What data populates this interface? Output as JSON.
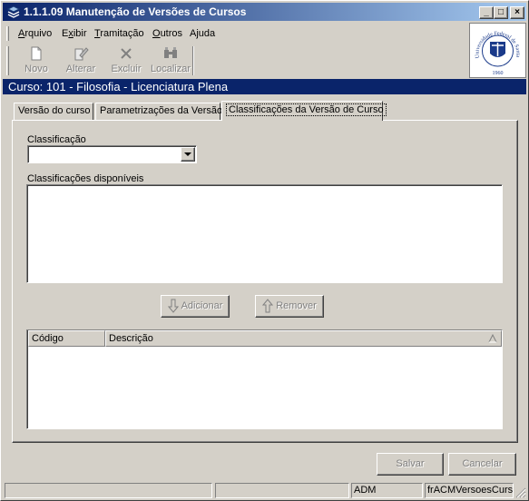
{
  "window": {
    "title": "1.1.1.09 Manutenção de Versões de Cursos",
    "controls": {
      "minimize": "_",
      "maximize": "□",
      "close": "×"
    }
  },
  "menu": [
    {
      "label": "Arquivo",
      "mnemonic": "A",
      "rest": "rquivo"
    },
    {
      "label": "Exibir",
      "mnemonic": "x",
      "prefix": "E",
      "rest": "ibir"
    },
    {
      "label": "Tramitação",
      "mnemonic": "T",
      "rest": "ramitação"
    },
    {
      "label": "Outros",
      "mnemonic": "O",
      "rest": "utros"
    },
    {
      "label": "Ajuda",
      "mnemonic": "j",
      "prefix": "A",
      "rest": "uda"
    }
  ],
  "toolbar": {
    "novo": "Novo",
    "alterar": "Alterar",
    "excluir": "Excluir",
    "localizar": "Localizar"
  },
  "logo": {
    "text": "Universidade Federal de Santa Maria",
    "year": "1960"
  },
  "course": "Curso: 101 - Filosofia - Licenciatura Plena",
  "tabs": [
    "Versão do curso",
    "Parametrizações da Versão",
    "Classificações da Versão de Curso"
  ],
  "form": {
    "classificacao_label": "Classificação",
    "classificacao_value": "",
    "disponiveis_label": "Classificações disponíveis",
    "adicionar": "Adicionar",
    "remover": "Remover"
  },
  "grid": {
    "columns": [
      "Código",
      "Descrição"
    ],
    "rows": []
  },
  "buttons": {
    "salvar": "Salvar",
    "cancelar": "Cancelar"
  },
  "status": [
    "",
    "",
    "ADM",
    "frACMVersoesCursc"
  ],
  "colors": {
    "title_start": "#0a246a",
    "title_end": "#a6caf0",
    "face": "#d4d0c8",
    "course_strip": "#0a246a"
  }
}
